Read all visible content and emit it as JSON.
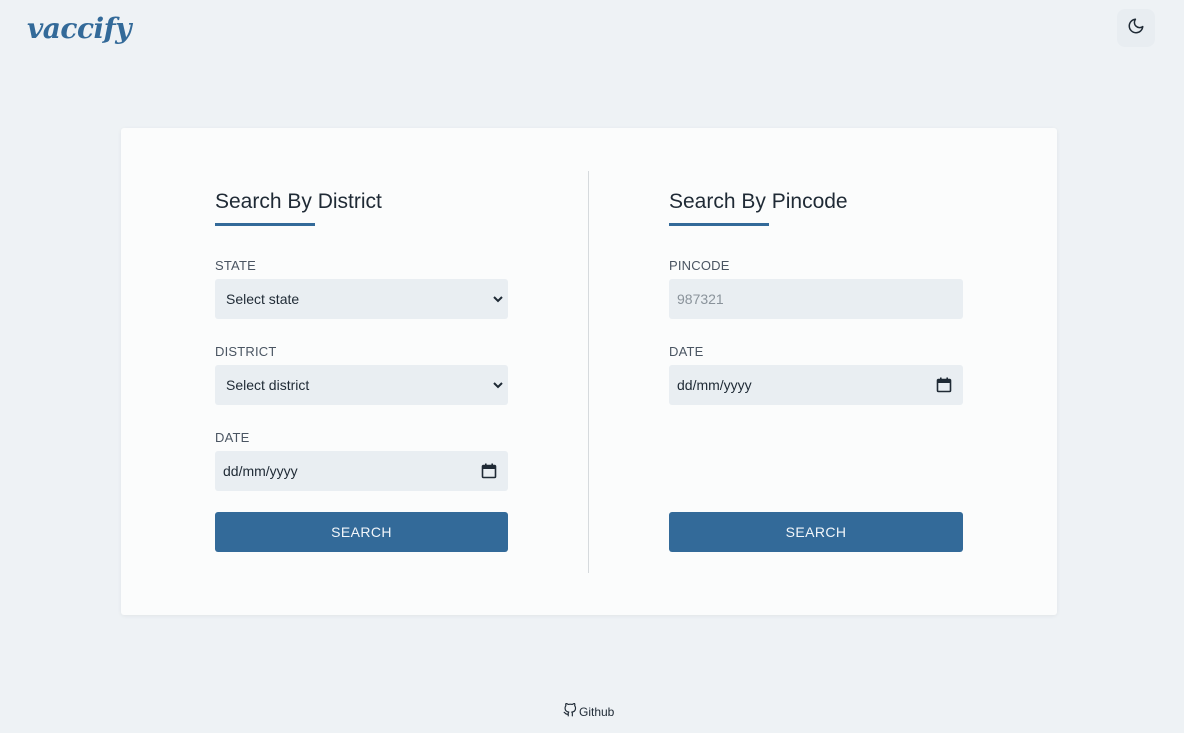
{
  "header": {
    "logo_text": "vaccify",
    "theme_toggle_icon": "moon-icon"
  },
  "district_search": {
    "title": "Search By District",
    "state_label": "STATE",
    "state_value": "Select state",
    "district_label": "DISTRICT",
    "district_value": "Select district",
    "date_label": "DATE",
    "date_value": "dd/mm/yyyy",
    "button_label": "SEARCH"
  },
  "pincode_search": {
    "title": "Search By Pincode",
    "pincode_label": "PINCODE",
    "pincode_placeholder": "987321",
    "date_label": "DATE",
    "date_value": "dd/mm/yyyy",
    "button_label": "SEARCH"
  },
  "footer": {
    "github_label": "Github",
    "github_icon": "github-icon"
  },
  "colors": {
    "accent": "#336a99",
    "background": "#eef2f5",
    "card": "#fbfcfc",
    "field": "#e9eef2"
  }
}
